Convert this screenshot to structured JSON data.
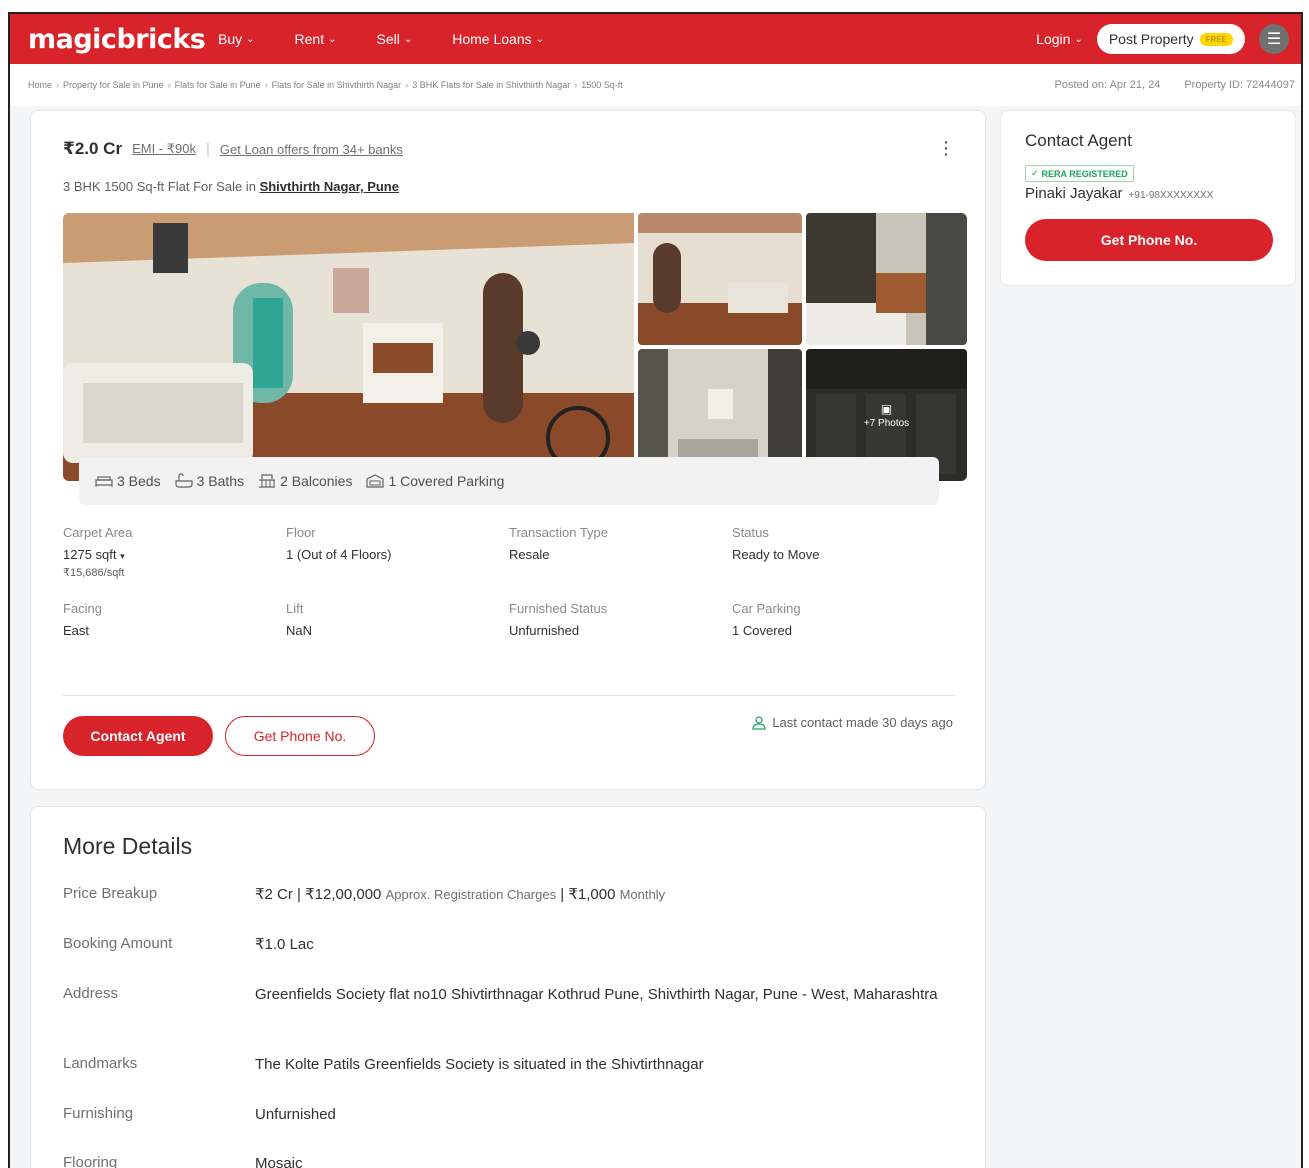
{
  "header": {
    "logo": "magicbricks",
    "nav": [
      {
        "label": "Buy"
      },
      {
        "label": "Rent"
      },
      {
        "label": "Sell"
      },
      {
        "label": "Home Loans"
      }
    ],
    "login_label": "Login",
    "post_property_label": "Post Property",
    "free_badge": "FREE"
  },
  "breadcrumbs": [
    "Home",
    "Property for Sale in Pune",
    "Flats for Sale in Pune",
    "Flats for Sale in Shivthirth Nagar",
    "3 BHK Flats for Sale in Shivthirth Nagar",
    "1500 Sq-ft"
  ],
  "post_info": {
    "posted_on": "Posted on: Apr 21, 24",
    "property_id": "Property ID: 72444097"
  },
  "listing": {
    "price": "₹2.0 Cr",
    "emi": "EMI - ₹90k",
    "loan_offers": "Get Loan offers from 34+ banks",
    "title_prefix": "3 BHK 1500 Sq-ft Flat For Sale in",
    "location": "Shivthirth Nagar, Pune",
    "more_photos": "+7 Photos",
    "amenities": [
      {
        "label": "3 Beds"
      },
      {
        "label": "3 Baths"
      },
      {
        "label": "2 Balconies"
      },
      {
        "label": "1 Covered Parking"
      }
    ],
    "specs": [
      {
        "label": "Carpet Area",
        "value": "1275 sqft",
        "sub": "₹15,686/sqft"
      },
      {
        "label": "Floor",
        "value": "1 (Out of 4 Floors)"
      },
      {
        "label": "Transaction Type",
        "value": "Resale"
      },
      {
        "label": "Status",
        "value": "Ready to Move"
      },
      {
        "label": "Facing",
        "value": "East"
      },
      {
        "label": "Lift",
        "value": "NaN"
      },
      {
        "label": "Furnished Status",
        "value": "Unfurnished"
      },
      {
        "label": "Car Parking",
        "value": "1 Covered"
      }
    ],
    "contact_agent_label": "Contact Agent",
    "get_phone_label": "Get Phone No.",
    "last_contact": "Last contact made 30 days ago"
  },
  "agent_card": {
    "title": "Contact Agent",
    "rera": "RERA REGISTERED",
    "name": "Pinaki Jayakar",
    "phone": "+91-98XXXXXXXX",
    "button_label": "Get Phone No."
  },
  "more_details": {
    "title": "More Details",
    "rows": [
      {
        "label": "Price Breakup",
        "value": "₹2 Cr | ₹12,00,000",
        "value_note": "Approx. Registration Charges",
        "value_extra": "| ₹1,000",
        "value_note2": "Monthly"
      },
      {
        "label": "Booking Amount",
        "value": "₹1.0 Lac"
      },
      {
        "label": "Address",
        "value": "Greenfields Society flat no10 Shivtirthnagar Kothrud Pune, Shivthirth Nagar, Pune - West, Maharashtra"
      },
      {
        "label": "Landmarks",
        "value": "The Kolte Patils Greenfields Society is situated in the Shivtirthnagar"
      },
      {
        "label": "Furnishing",
        "value": "Unfurnished"
      },
      {
        "label": "Flooring",
        "value": "Mosaic"
      }
    ]
  },
  "colors": {
    "brand_red": "#d8232a",
    "rera_green": "#1aa55c"
  }
}
